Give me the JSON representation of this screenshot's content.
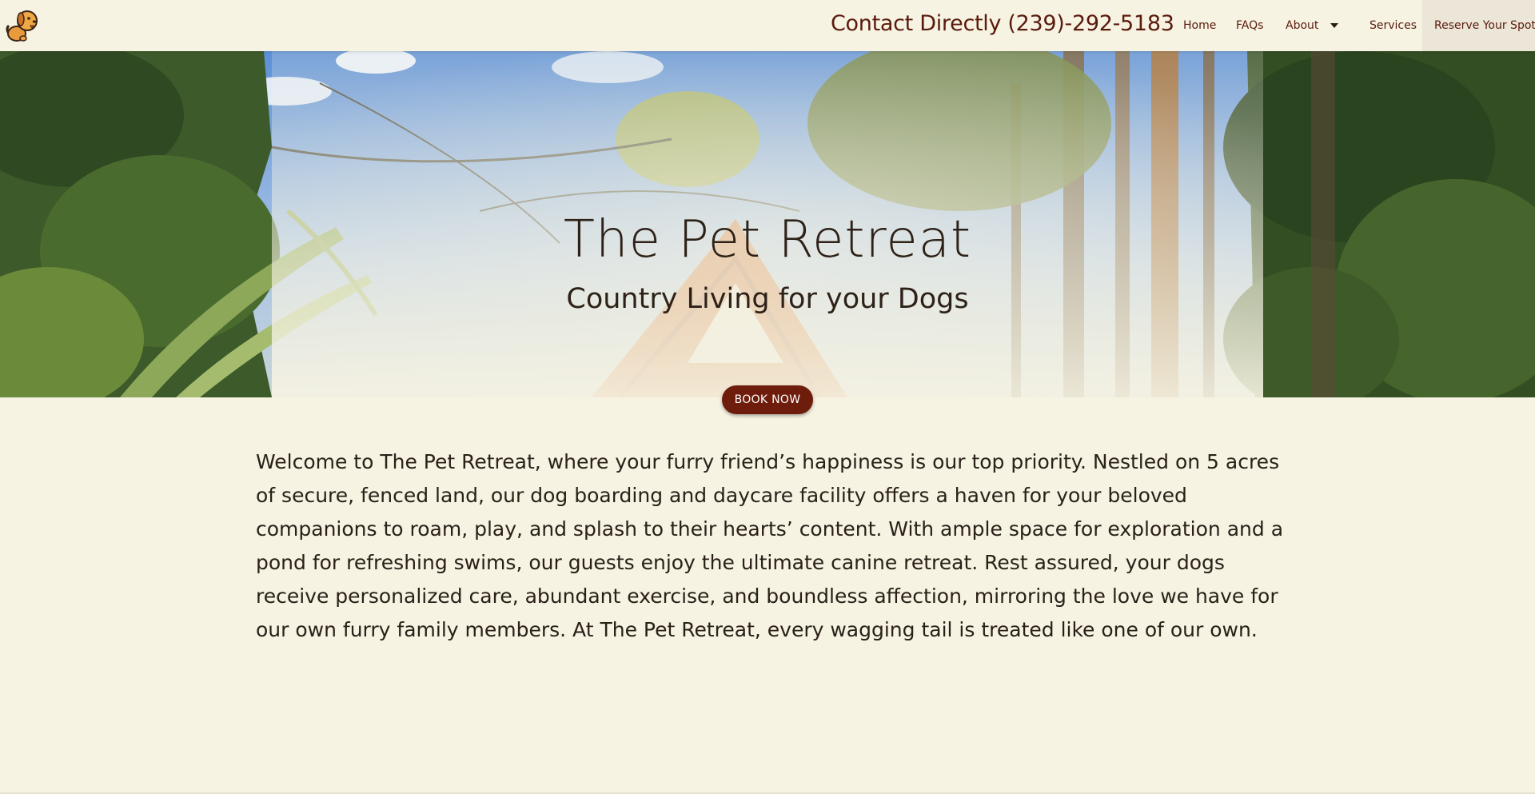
{
  "header": {
    "logo_icon": "dog-mascot-icon",
    "contact": "Contact Directly (239)-292-5183",
    "nav": {
      "home": "Home",
      "faqs": "FAQs",
      "about": "About",
      "services": "Services",
      "reserve": "Reserve Your Spot"
    }
  },
  "hero": {
    "title": "The Pet Retreat",
    "subtitle": "Country Living for your Dogs",
    "button": "BOOK NOW"
  },
  "main": {
    "welcome": "Welcome to The Pet Retreat, where your furry friend’s happiness is our top priority. Nestled on 5 acres of secure, fenced land, our dog boarding and daycare facility offers a haven for your beloved companions to roam, play, and splash to their hearts’ content. With ample space for exploration and a pond for refreshing swims, our guests enjoy the ultimate canine retreat. Rest assured, your dogs receive personalized care, abundant exercise, and boundless affection, mirroring the love we have for our own furry family members. At The Pet Retreat, every wagging tail is treated like one of our own."
  },
  "colors": {
    "background": "#f6f3e3",
    "accent": "#6e1c0b",
    "nav_text": "#5a1a0c",
    "body_text": "#2a2018"
  }
}
